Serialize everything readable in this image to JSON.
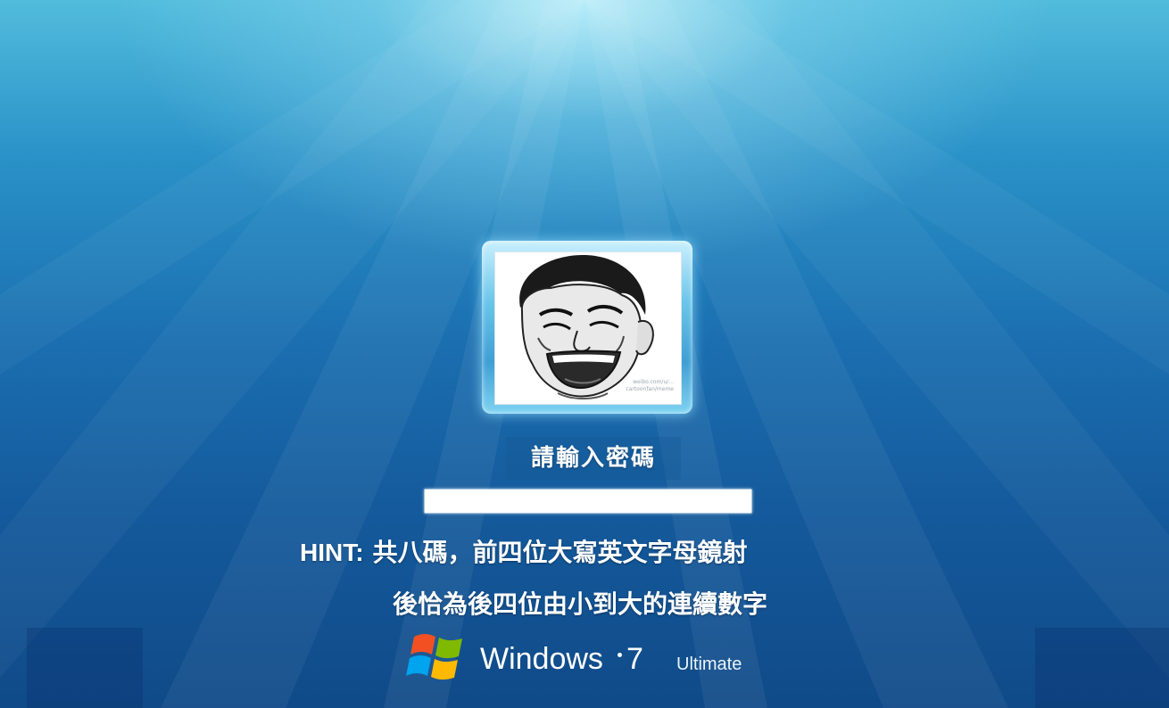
{
  "login": {
    "prompt_label": "請輸入密碼",
    "password_value": "",
    "hint_prefix": "HINT:",
    "hint_line1": "共八碼，前四位大寫英文字母鏡射",
    "hint_line2": "後恰為後四位由小到大的連續數字"
  },
  "avatar": {
    "watermark_line1": "weibo.com/u/...",
    "watermark_line2": "cartoonfan/meme"
  },
  "branding": {
    "product": "Windows",
    "version": "7",
    "edition": "Ultimate"
  },
  "colors": {
    "background_top": "#52bcdc",
    "background_bottom": "#104a88",
    "logo_red": "#f25022",
    "logo_green": "#7fba00",
    "logo_blue": "#00a4ef",
    "logo_yellow": "#ffb900"
  }
}
